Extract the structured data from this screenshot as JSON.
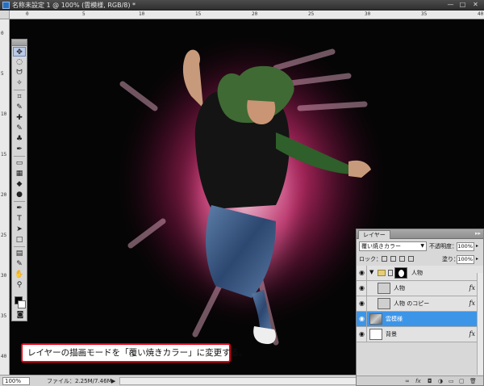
{
  "window": {
    "title": "名称未設定 1 @ 100% (雲模様, RGB/8) *",
    "buttons": {
      "minimize": "—",
      "maximize": "□",
      "close": "✕"
    }
  },
  "rulers": {
    "top_labels": [
      "0",
      "5",
      "10",
      "15",
      "20",
      "25",
      "30",
      "35",
      "40"
    ],
    "left_labels": [
      "0",
      "5",
      "10",
      "15",
      "20",
      "25",
      "30",
      "35",
      "40"
    ]
  },
  "toolbox": {
    "tools": [
      {
        "name": "move-tool",
        "glyph": "✥",
        "active": true
      },
      {
        "name": "marquee-tool",
        "glyph": "◌"
      },
      {
        "name": "lasso-tool",
        "glyph": "ᗢ"
      },
      {
        "name": "magic-wand-tool",
        "glyph": "✧"
      },
      {
        "name": "crop-tool",
        "glyph": "⌗"
      },
      {
        "name": "slice-tool",
        "glyph": "✎"
      },
      {
        "name": "healing-brush-tool",
        "glyph": "✚"
      },
      {
        "name": "brush-tool",
        "glyph": "✎"
      },
      {
        "name": "clone-stamp-tool",
        "glyph": "♣"
      },
      {
        "name": "history-brush-tool",
        "glyph": "✒"
      },
      {
        "name": "eraser-tool",
        "glyph": "▭"
      },
      {
        "name": "gradient-tool",
        "glyph": "▦"
      },
      {
        "name": "blur-tool",
        "glyph": "◆"
      },
      {
        "name": "dodge-tool",
        "glyph": "●"
      },
      {
        "name": "pen-tool",
        "glyph": "✒"
      },
      {
        "name": "type-tool",
        "glyph": "T"
      },
      {
        "name": "path-selection-tool",
        "glyph": "➤"
      },
      {
        "name": "shape-tool",
        "glyph": "□"
      },
      {
        "name": "notes-tool",
        "glyph": "▤"
      },
      {
        "name": "eyedropper-tool",
        "glyph": "✎"
      },
      {
        "name": "hand-tool",
        "glyph": "✋"
      },
      {
        "name": "zoom-tool",
        "glyph": "⚲"
      }
    ]
  },
  "caption": {
    "text": "レイヤーの描画モードを「覆い焼きカラー」に変更する。"
  },
  "statusbar": {
    "zoom": "100%",
    "file_info": "ファイル：2.25M/7.46M",
    "arrow": "▶"
  },
  "layers_panel": {
    "tab": "レイヤー",
    "collapse": "▸▸",
    "blend_mode": "覆い焼きカラー",
    "opacity_label": "不透明度：",
    "opacity_value": "100%",
    "lock_label": "ロック：",
    "fill_label": "塗り：",
    "fill_value": "100%",
    "layers": [
      {
        "name": "人物",
        "type": "group",
        "fx": ""
      },
      {
        "name": "人物",
        "type": "layer",
        "fx": "fx"
      },
      {
        "name": "人物 のコピー",
        "type": "layer",
        "fx": "fx"
      },
      {
        "name": "雲模様",
        "type": "layer",
        "fx": "",
        "selected": true
      },
      {
        "name": "背景",
        "type": "layer",
        "fx": "fx"
      }
    ],
    "bottom_icons": [
      "∞",
      "fx",
      "◘",
      "◑",
      "▭",
      "▢",
      "🗑"
    ]
  },
  "colors": {
    "glow": "#e4317a",
    "selected_layer": "#3d95e8",
    "caption_border": "#e60012"
  }
}
